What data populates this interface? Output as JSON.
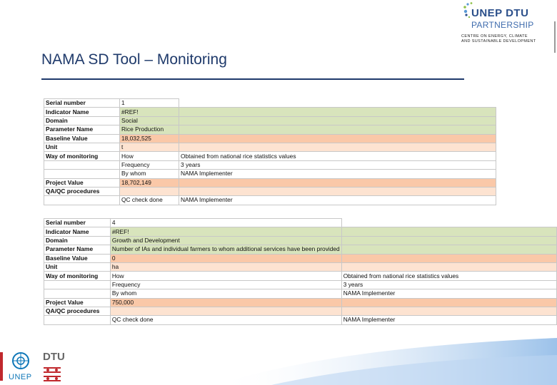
{
  "header": {
    "title": "NAMA SD Tool – Monitoring",
    "logo": {
      "line1": "UNEP DTU",
      "line2": "PARTNERSHIP",
      "line3": "CENTRE ON ENERGY, CLIMATE",
      "line4": "AND SUSTAINABLE DEVELOPMENT"
    }
  },
  "tables": [
    {
      "rows": [
        {
          "label": "Serial number",
          "c1": "1",
          "c2": ""
        },
        {
          "label": "Indicator Name",
          "c1": "#REF!",
          "c2": ""
        },
        {
          "label": "Domain",
          "c1": "Social",
          "c2": ""
        },
        {
          "label": "Parameter Name",
          "c1": "Rice Production",
          "c2": ""
        },
        {
          "label": "Baseline Value",
          "c1": "18,032,525",
          "c2": ""
        },
        {
          "label": "Unit",
          "c1": "t",
          "c2": ""
        },
        {
          "label": "Way of monitoring",
          "c1": "How",
          "c2": "Obtained from national rice statistics values"
        },
        {
          "label": "",
          "c1": "Frequency",
          "c2": "3 years"
        },
        {
          "label": "",
          "c1": "By whom",
          "c2": "NAMA Implementer"
        },
        {
          "label": "Project Value",
          "c1": "18,702,149",
          "c2": ""
        },
        {
          "label": "QA/QC procedures",
          "c1": "",
          "c2": ""
        },
        {
          "label": "",
          "c1": "QC check done",
          "c2": "NAMA Implementer"
        }
      ]
    },
    {
      "rows": [
        {
          "label": "Serial number",
          "c1": "4",
          "c2": ""
        },
        {
          "label": "Indicator Name",
          "c1": "#REF!",
          "c2": ""
        },
        {
          "label": "Domain",
          "c1": "Growth and Development",
          "c2": ""
        },
        {
          "label": "Parameter Name",
          "c1": "Number of IAs and individual farmers to whom additional services have been provided",
          "c2": ""
        },
        {
          "label": "Baseline Value",
          "c1": "0",
          "c2": ""
        },
        {
          "label": "Unit",
          "c1": "ha",
          "c2": ""
        },
        {
          "label": "Way of monitoring",
          "c1": "How",
          "c2": "Obtained from national rice statistics values"
        },
        {
          "label": "",
          "c1": "Frequency",
          "c2": "3 years"
        },
        {
          "label": "",
          "c1": "By whom",
          "c2": "NAMA Implementer"
        },
        {
          "label": "Project Value",
          "c1": "750,000",
          "c2": ""
        },
        {
          "label": "QA/QC procedures",
          "c1": "",
          "c2": ""
        },
        {
          "label": "",
          "c1": "QC check done",
          "c2": "NAMA Implementer"
        }
      ]
    }
  ],
  "footer": {
    "unep": "UNEP",
    "dtu": "DTU"
  },
  "colors": {
    "title": "#1f3a6b",
    "green_fill": "#d8e4bc",
    "peach_fill": "#fac8a8",
    "light_peach_fill": "#fde3d1"
  }
}
